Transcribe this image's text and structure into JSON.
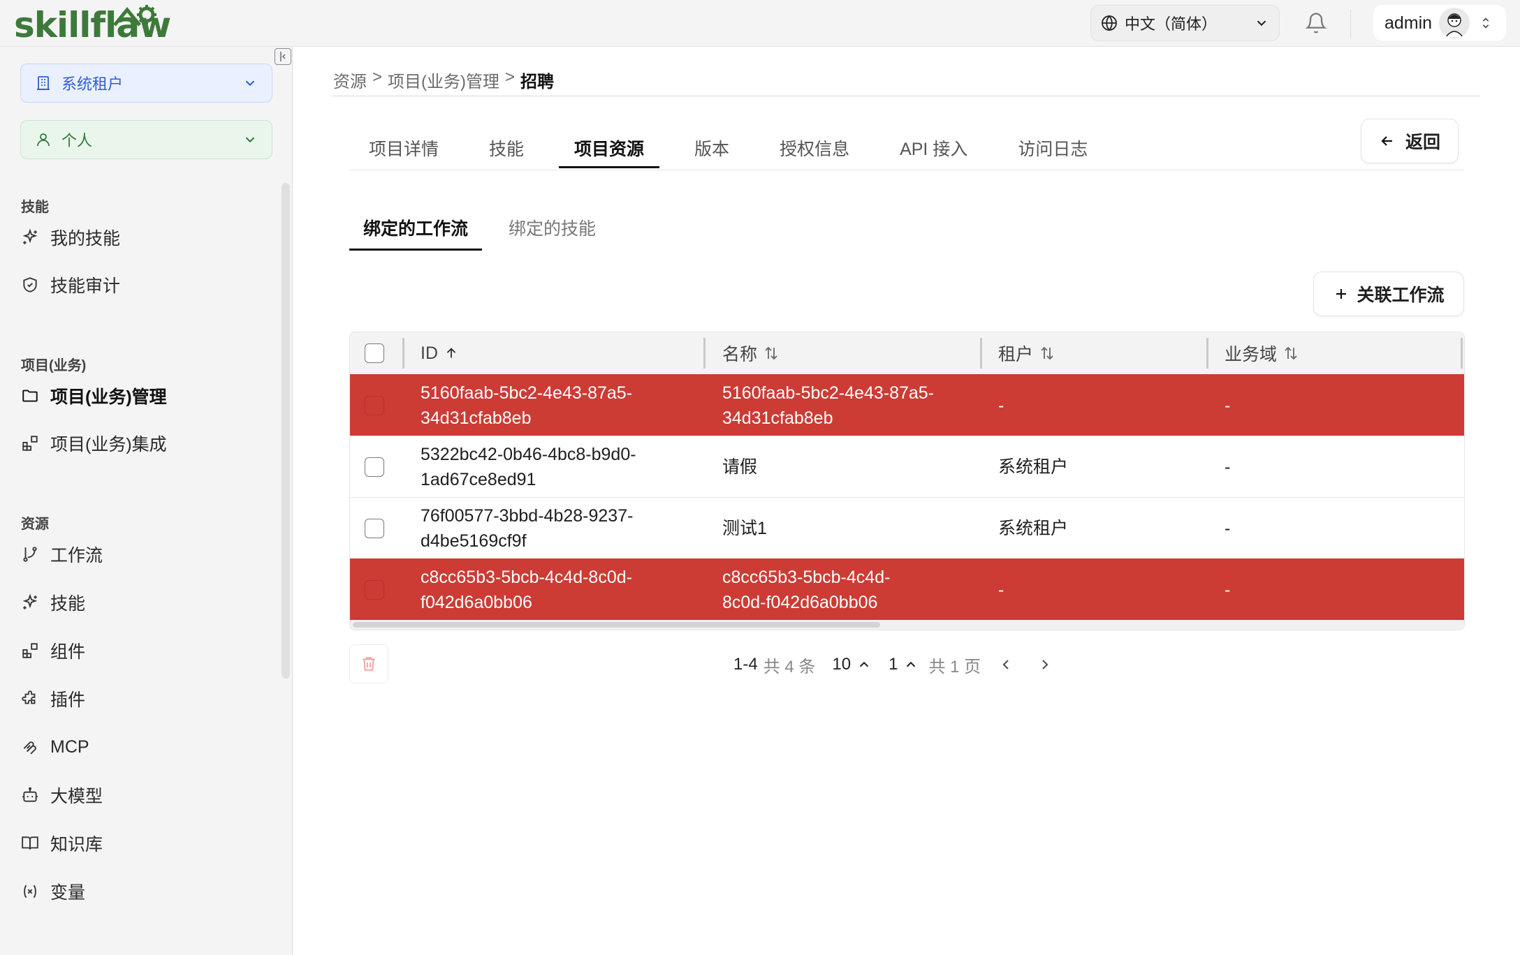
{
  "brand": {
    "name": "skillflaw",
    "color": "#3d7a3a"
  },
  "header": {
    "language": "中文（简体）",
    "user": "admin"
  },
  "sidebar": {
    "tenant": "系统租户",
    "scope": "个人",
    "sections": [
      {
        "title": "技能",
        "items": [
          {
            "label": "我的技能",
            "icon": "sparkle-icon"
          },
          {
            "label": "技能审计",
            "icon": "shield-check-icon"
          }
        ]
      },
      {
        "title": "项目(业务)",
        "items": [
          {
            "label": "项目(业务)管理",
            "icon": "folder-icon",
            "active": true
          },
          {
            "label": "项目(业务)集成",
            "icon": "blocks-icon"
          }
        ]
      },
      {
        "title": "资源",
        "items": [
          {
            "label": "工作流",
            "icon": "git-branch-icon"
          },
          {
            "label": "技能",
            "icon": "sparkle-icon"
          },
          {
            "label": "组件",
            "icon": "blocks-icon"
          },
          {
            "label": "插件",
            "icon": "puzzle-icon"
          },
          {
            "label": "MCP",
            "icon": "mcp-icon"
          },
          {
            "label": "大模型",
            "icon": "bot-icon"
          },
          {
            "label": "知识库",
            "icon": "book-icon"
          },
          {
            "label": "变量",
            "icon": "variable-icon"
          }
        ]
      }
    ]
  },
  "breadcrumb": {
    "items": [
      "资源",
      "项目(业务)管理"
    ],
    "current": "招聘",
    "separator": ">"
  },
  "tabs": [
    "项目详情",
    "技能",
    "项目资源",
    "版本",
    "授权信息",
    "API 接入",
    "访问日志"
  ],
  "active_tab": "项目资源",
  "back_label": "返回",
  "subtabs": [
    "绑定的工作流",
    "绑定的技能"
  ],
  "active_subtab": "绑定的工作流",
  "link_button": "关联工作流",
  "table": {
    "columns": [
      {
        "label": "ID",
        "sort": "asc"
      },
      {
        "label": "名称",
        "sort": "none"
      },
      {
        "label": "租户",
        "sort": "none"
      },
      {
        "label": "业务域",
        "sort": "none"
      }
    ],
    "rows": [
      {
        "id_l1": "5160faab-5bc2-4e43-87a5-",
        "id_l2": "34d31cfab8eb",
        "name_l1": "5160faab-5bc2-4e43-87a5-",
        "name_l2": "34d31cfab8eb",
        "tenant": "-",
        "domain": "-",
        "highlight": true
      },
      {
        "id_l1": "5322bc42-0b46-4bc8-b9d0-",
        "id_l2": "1ad67ce8ed91",
        "name_l1": "请假",
        "name_l2": "",
        "tenant": "系统租户",
        "domain": "-",
        "highlight": false
      },
      {
        "id_l1": "76f00577-3bbd-4b28-9237-",
        "id_l2": "d4be5169cf9f",
        "name_l1": "测试1",
        "name_l2": "",
        "tenant": "系统租户",
        "domain": "-",
        "highlight": false
      },
      {
        "id_l1": "c8cc65b3-5bcb-4c4d-8c0d-",
        "id_l2": "f042d6a0bb06",
        "name_l1": "c8cc65b3-5bcb-4c4d-",
        "name_l2": "8c0d-f042d6a0bb06",
        "tenant": "-",
        "domain": "-",
        "highlight": true
      }
    ],
    "highlight_color": "#cc3b34"
  },
  "pagination": {
    "range": "1-4",
    "total_label": "共 4 条",
    "page_size": "10",
    "page": "1",
    "pages_label": "共 1 页"
  }
}
